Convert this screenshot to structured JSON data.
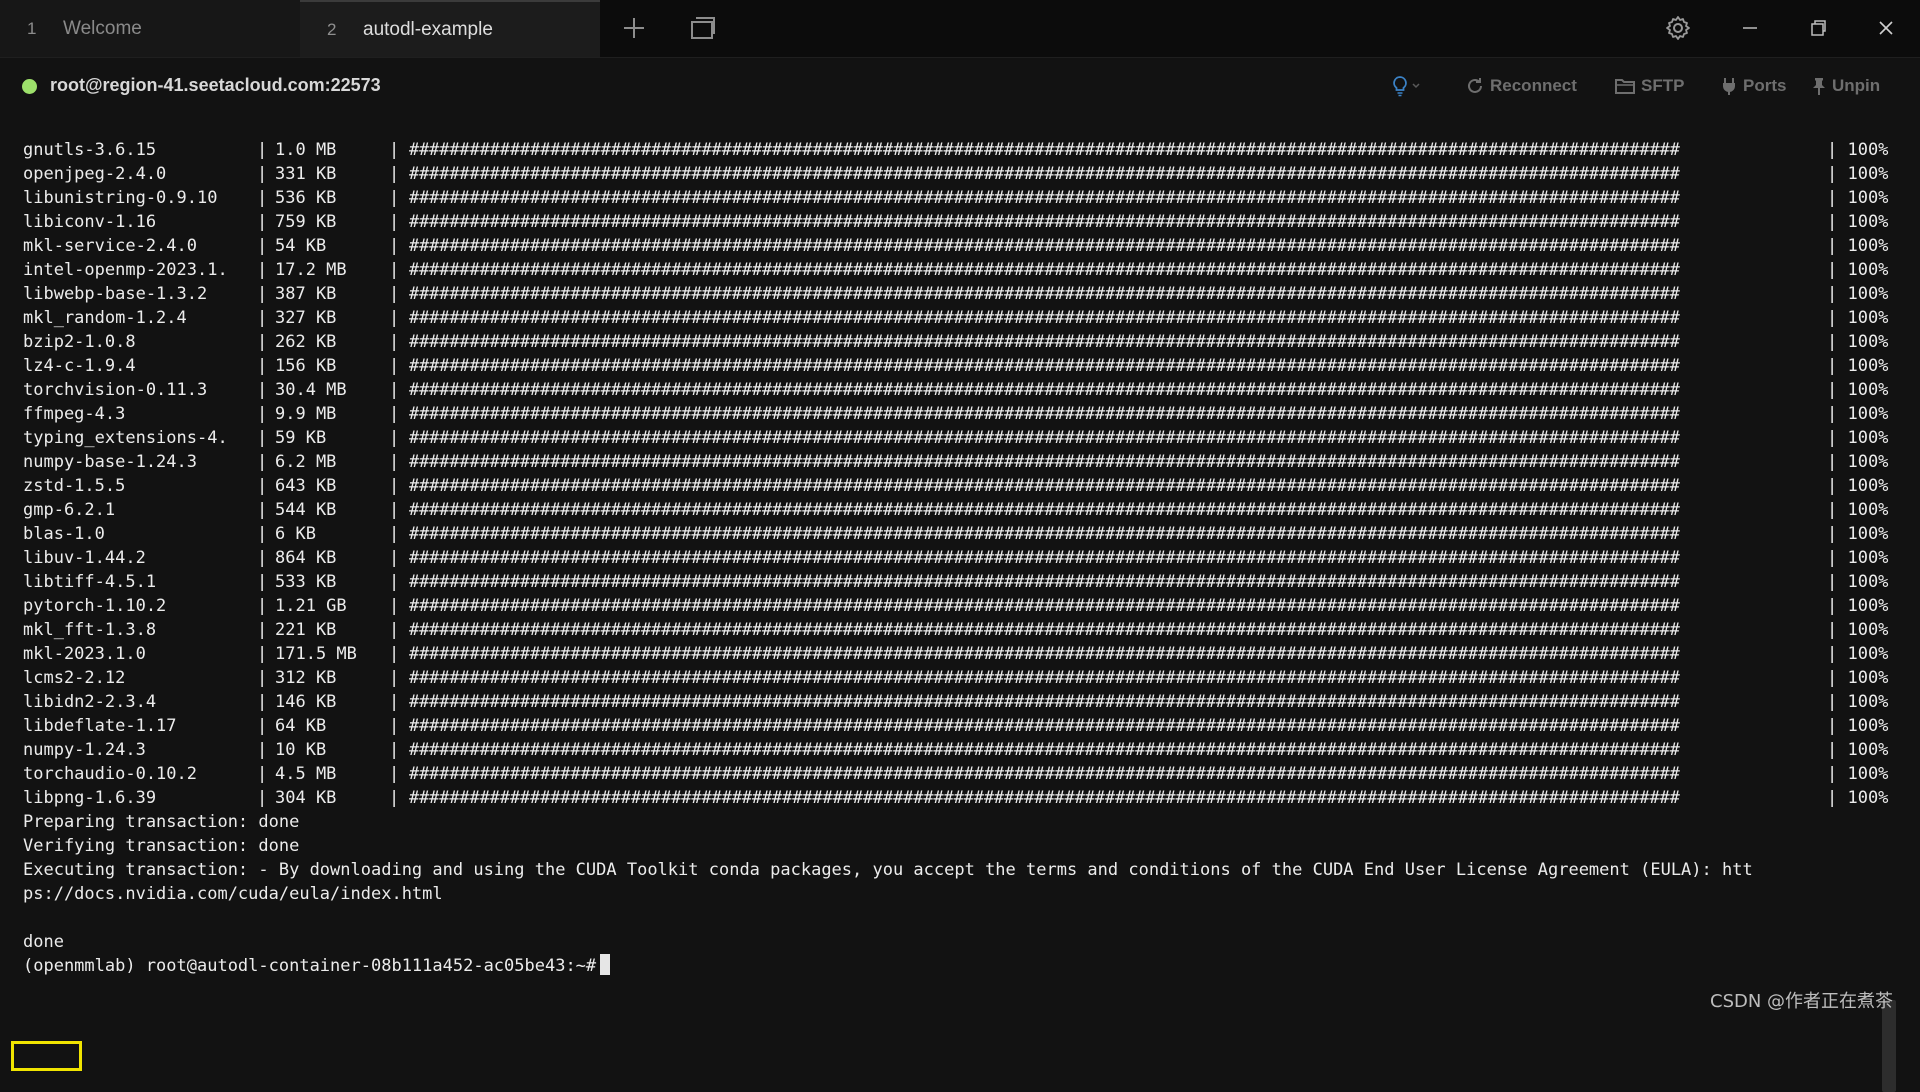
{
  "tabs": [
    {
      "num": "1",
      "label": "Welcome"
    },
    {
      "num": "2",
      "label": "autodl-example"
    }
  ],
  "session": {
    "host": "root@region-41.seetacloud.com:22573",
    "status_color": "#9de06b",
    "actions": {
      "reconnect": "Reconnect",
      "sftp": "SFTP",
      "ports": "Ports",
      "unpin": "Unpin"
    }
  },
  "packages": [
    {
      "name": "gnutls-3.6.15",
      "size": "1.0 MB",
      "pct": "100%"
    },
    {
      "name": "openjpeg-2.4.0",
      "size": "331 KB",
      "pct": "100%"
    },
    {
      "name": "libunistring-0.9.10",
      "size": "536 KB",
      "pct": "100%"
    },
    {
      "name": "libiconv-1.16",
      "size": "759 KB",
      "pct": "100%"
    },
    {
      "name": "mkl-service-2.4.0",
      "size": "54 KB",
      "pct": "100%"
    },
    {
      "name": "intel-openmp-2023.1.",
      "size": "17.2 MB",
      "pct": "100%"
    },
    {
      "name": "libwebp-base-1.3.2",
      "size": "387 KB",
      "pct": "100%"
    },
    {
      "name": "mkl_random-1.2.4",
      "size": "327 KB",
      "pct": "100%"
    },
    {
      "name": "bzip2-1.0.8",
      "size": "262 KB",
      "pct": "100%"
    },
    {
      "name": "lz4-c-1.9.4",
      "size": "156 KB",
      "pct": "100%"
    },
    {
      "name": "torchvision-0.11.3",
      "size": "30.4 MB",
      "pct": "100%"
    },
    {
      "name": "ffmpeg-4.3",
      "size": "9.9 MB",
      "pct": "100%"
    },
    {
      "name": "typing_extensions-4.",
      "size": "59 KB",
      "pct": "100%"
    },
    {
      "name": "numpy-base-1.24.3",
      "size": "6.2 MB",
      "pct": "100%"
    },
    {
      "name": "zstd-1.5.5",
      "size": "643 KB",
      "pct": "100%"
    },
    {
      "name": "gmp-6.2.1",
      "size": "544 KB",
      "pct": "100%"
    },
    {
      "name": "blas-1.0",
      "size": "6 KB",
      "pct": "100%"
    },
    {
      "name": "libuv-1.44.2",
      "size": "864 KB",
      "pct": "100%"
    },
    {
      "name": "libtiff-4.5.1",
      "size": "533 KB",
      "pct": "100%"
    },
    {
      "name": "pytorch-1.10.2",
      "size": "1.21 GB",
      "pct": "100%"
    },
    {
      "name": "mkl_fft-1.3.8",
      "size": "221 KB",
      "pct": "100%"
    },
    {
      "name": "mkl-2023.1.0",
      "size": "171.5 MB",
      "pct": "100%"
    },
    {
      "name": "lcms2-2.12",
      "size": "312 KB",
      "pct": "100%"
    },
    {
      "name": "libidn2-2.3.4",
      "size": "146 KB",
      "pct": "100%"
    },
    {
      "name": "libdeflate-1.17",
      "size": "64 KB",
      "pct": "100%"
    },
    {
      "name": "numpy-1.24.3",
      "size": "10 KB",
      "pct": "100%"
    },
    {
      "name": "torchaudio-0.10.2",
      "size": "4.5 MB",
      "pct": "100%"
    },
    {
      "name": "libpng-1.6.39",
      "size": "304 KB",
      "pct": "100%"
    }
  ],
  "progress_bar_text": "##############################################################################################################################",
  "terminal_lines": [
    "Preparing transaction: done",
    "Verifying transaction: done",
    "Executing transaction: - By downloading and using the CUDA Toolkit conda packages, you accept the terms and conditions of the CUDA End User License Agreement (EULA): htt",
    "ps://docs.nvidia.com/cuda/eula/index.html",
    "",
    "done"
  ],
  "prompt": "(openmmlab) root@autodl-container-08b111a452-ac05be43:~#",
  "watermark": "CSDN @作者正在煮茶",
  "highlight_color": "#f0e400"
}
